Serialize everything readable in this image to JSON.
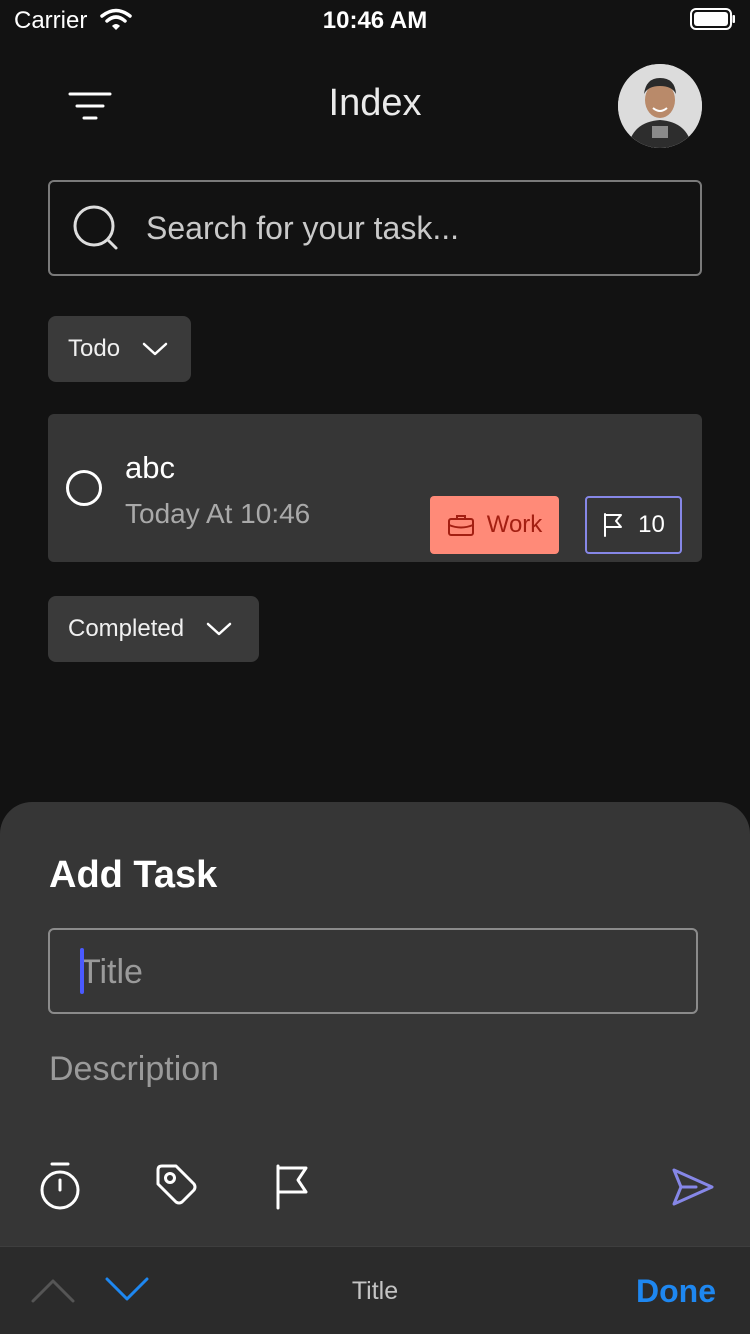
{
  "status_bar": {
    "carrier": "Carrier",
    "time": "10:46 AM"
  },
  "header": {
    "title": "Index"
  },
  "search": {
    "placeholder": "Search for your task..."
  },
  "groups": {
    "todo_label": "Todo",
    "completed_label": "Completed"
  },
  "tasks": [
    {
      "title": "abc",
      "time": "Today At 10:46",
      "category": "Work",
      "category_color": "#ff8a78",
      "priority": "10",
      "priority_color": "#8687e7"
    }
  ],
  "add_task": {
    "title": "Add Task",
    "title_placeholder": "Title",
    "description_placeholder": "Description",
    "accent": "#8687e7"
  },
  "keyboard_toolbar": {
    "field_label": "Title",
    "done_label": "Done",
    "done_color": "#1e87f0"
  }
}
